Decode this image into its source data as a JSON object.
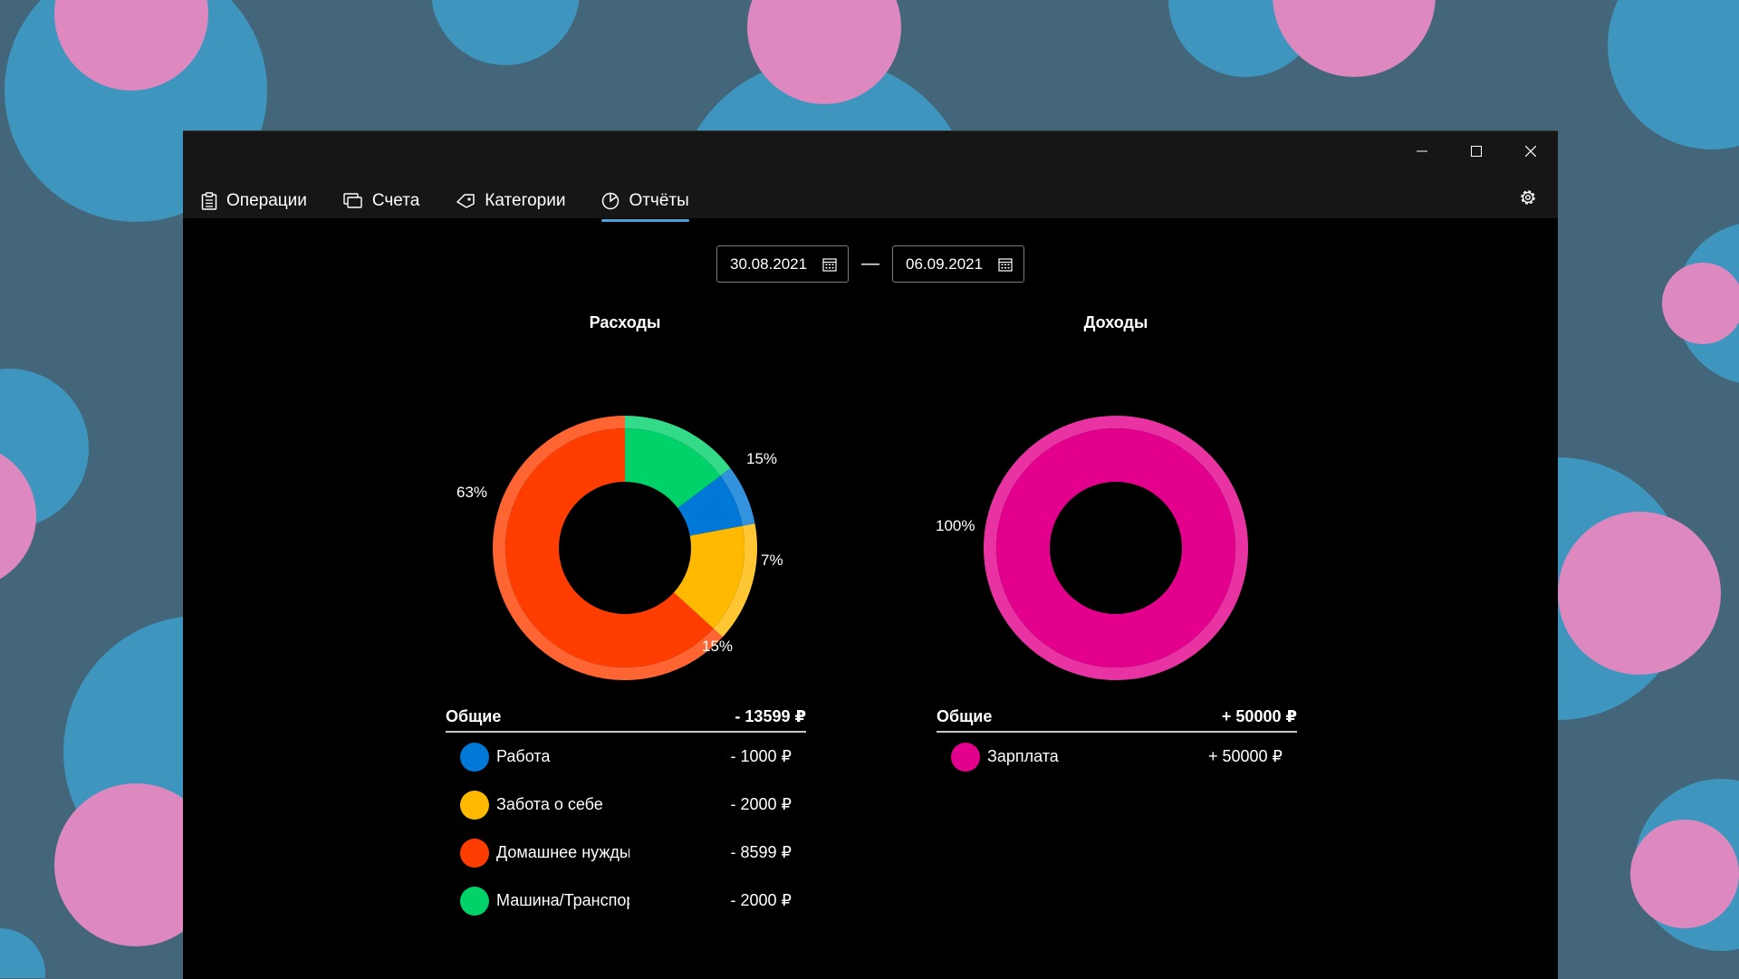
{
  "tabs": [
    {
      "label": "Операции",
      "icon": "clipboard-icon"
    },
    {
      "label": "Счета",
      "icon": "accounts-icon"
    },
    {
      "label": "Категории",
      "icon": "tag-icon"
    },
    {
      "label": "Отчёты",
      "icon": "pie-chart-icon",
      "active": true
    }
  ],
  "date_range": {
    "from": "30.08.2021",
    "separator": "—",
    "to": "06.09.2021"
  },
  "colors": {
    "accent": "#46a3db",
    "expense_other": "#ff3d00",
    "transport": "#00d26a",
    "work": "#0078d7",
    "self_care": "#ffb900",
    "salary": "#e3008c"
  },
  "chart_data": [
    {
      "type": "pie",
      "title": "Расходы",
      "series": [
        {
          "name": "Машина/Транспорт",
          "value": 2000,
          "label": "15%",
          "color": "#00d26a"
        },
        {
          "name": "Работа",
          "value": 1000,
          "label": "7%",
          "color": "#0078d7"
        },
        {
          "name": "Забота о себе",
          "value": 2000,
          "label": "15%",
          "color": "#ffb900"
        },
        {
          "name": "Домашнее нужды",
          "value": 8599,
          "label": "63%",
          "color": "#ff3d00"
        }
      ]
    },
    {
      "type": "pie",
      "title": "Доходы",
      "series": [
        {
          "name": "Зарплата",
          "value": 50000,
          "label": "100%",
          "color": "#e3008c"
        }
      ]
    }
  ],
  "expenses": {
    "title": "Расходы",
    "total_label": "Общие",
    "total": "- 13599 ₽",
    "items": [
      {
        "name": "Работа",
        "amount": "- 1000 ₽",
        "color": "#0078d7"
      },
      {
        "name": "Забота о себе",
        "amount": "- 2000 ₽",
        "color": "#ffb900"
      },
      {
        "name": "Домашнее нужды",
        "amount": "- 8599 ₽",
        "color": "#ff3d00"
      },
      {
        "name": "Машина/Транспорт",
        "amount": "- 2000 ₽",
        "color": "#00d26a"
      }
    ]
  },
  "income": {
    "title": "Доходы",
    "total_label": "Общие",
    "total": "+ 50000 ₽",
    "items": [
      {
        "name": "Зарплата",
        "amount": "+ 50000 ₽",
        "color": "#e3008c"
      }
    ]
  }
}
